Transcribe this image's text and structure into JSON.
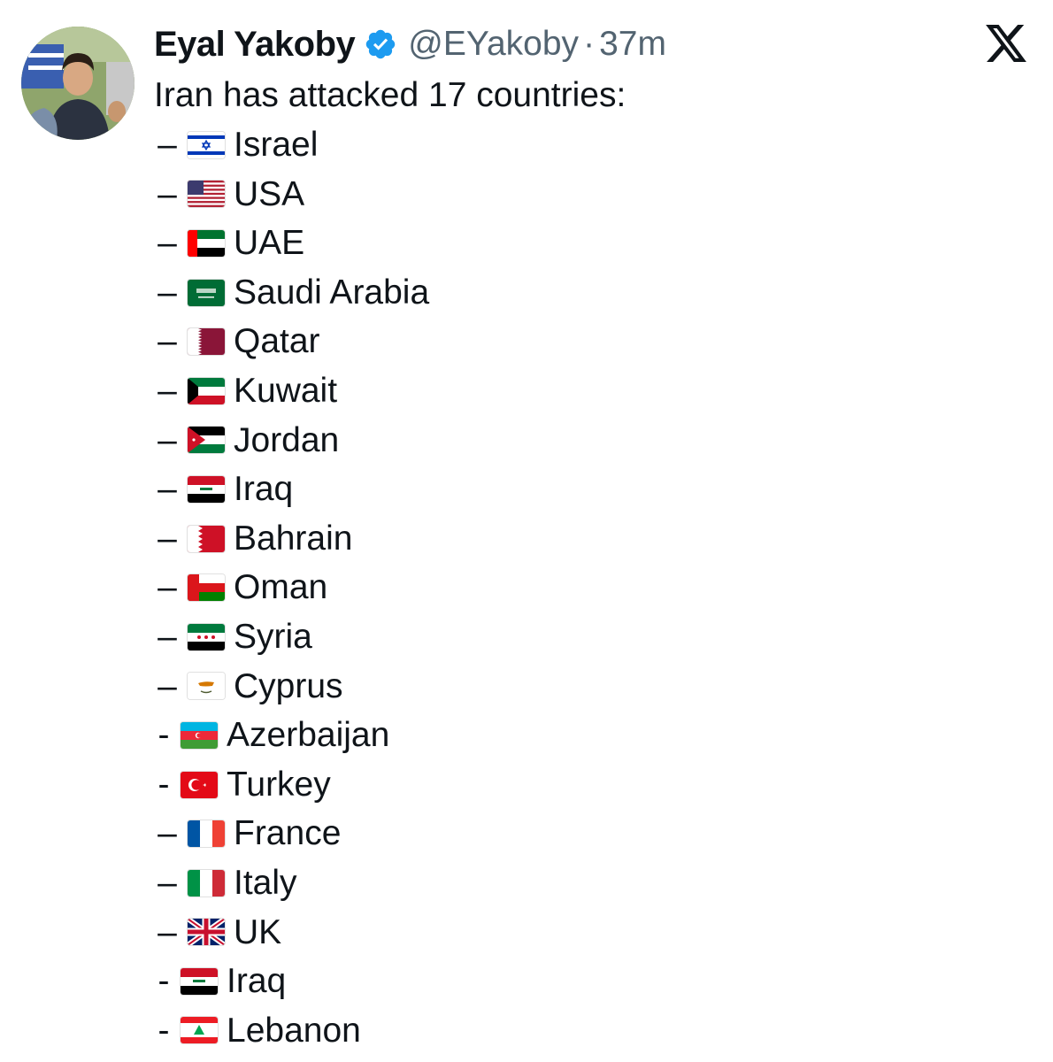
{
  "author": {
    "name": "Eyal Yakoby",
    "handle": "@EYakoby",
    "separator": "·",
    "time": "37m"
  },
  "post": {
    "intro": "Iran has attacked 17 countries:",
    "items": [
      {
        "dash": "–",
        "flag": "israel",
        "country": "Israel"
      },
      {
        "dash": "–",
        "flag": "usa",
        "country": "USA"
      },
      {
        "dash": "–",
        "flag": "uae",
        "country": "UAE"
      },
      {
        "dash": "–",
        "flag": "saudi-arabia",
        "country": "Saudi Arabia"
      },
      {
        "dash": "–",
        "flag": "qatar",
        "country": "Qatar"
      },
      {
        "dash": "–",
        "flag": "kuwait",
        "country": "Kuwait"
      },
      {
        "dash": "–",
        "flag": "jordan",
        "country": "Jordan"
      },
      {
        "dash": "–",
        "flag": "iraq",
        "country": "Iraq"
      },
      {
        "dash": "–",
        "flag": "bahrain",
        "country": "Bahrain"
      },
      {
        "dash": "–",
        "flag": "oman",
        "country": "Oman"
      },
      {
        "dash": "–",
        "flag": "syria",
        "country": "Syria"
      },
      {
        "dash": "–",
        "flag": "cyprus",
        "country": "Cyprus"
      },
      {
        "dash": "-",
        "flag": "azerbaijan",
        "country": "Azerbaijan"
      },
      {
        "dash": "-",
        "flag": "turkey",
        "country": "Turkey"
      },
      {
        "dash": "–",
        "flag": "france",
        "country": "France"
      },
      {
        "dash": "–",
        "flag": "italy",
        "country": "Italy"
      },
      {
        "dash": "–",
        "flag": "uk",
        "country": "UK"
      },
      {
        "dash": "-",
        "flag": "iraq",
        "country": "Iraq"
      },
      {
        "dash": "-",
        "flag": "lebanon",
        "country": "Lebanon"
      }
    ]
  },
  "icons": {
    "verified": "verified-badge-icon",
    "logo": "x-logo-icon"
  },
  "colors": {
    "verified_blue": "#1d9bf0",
    "text": "#0f1419",
    "secondary": "#536471"
  }
}
